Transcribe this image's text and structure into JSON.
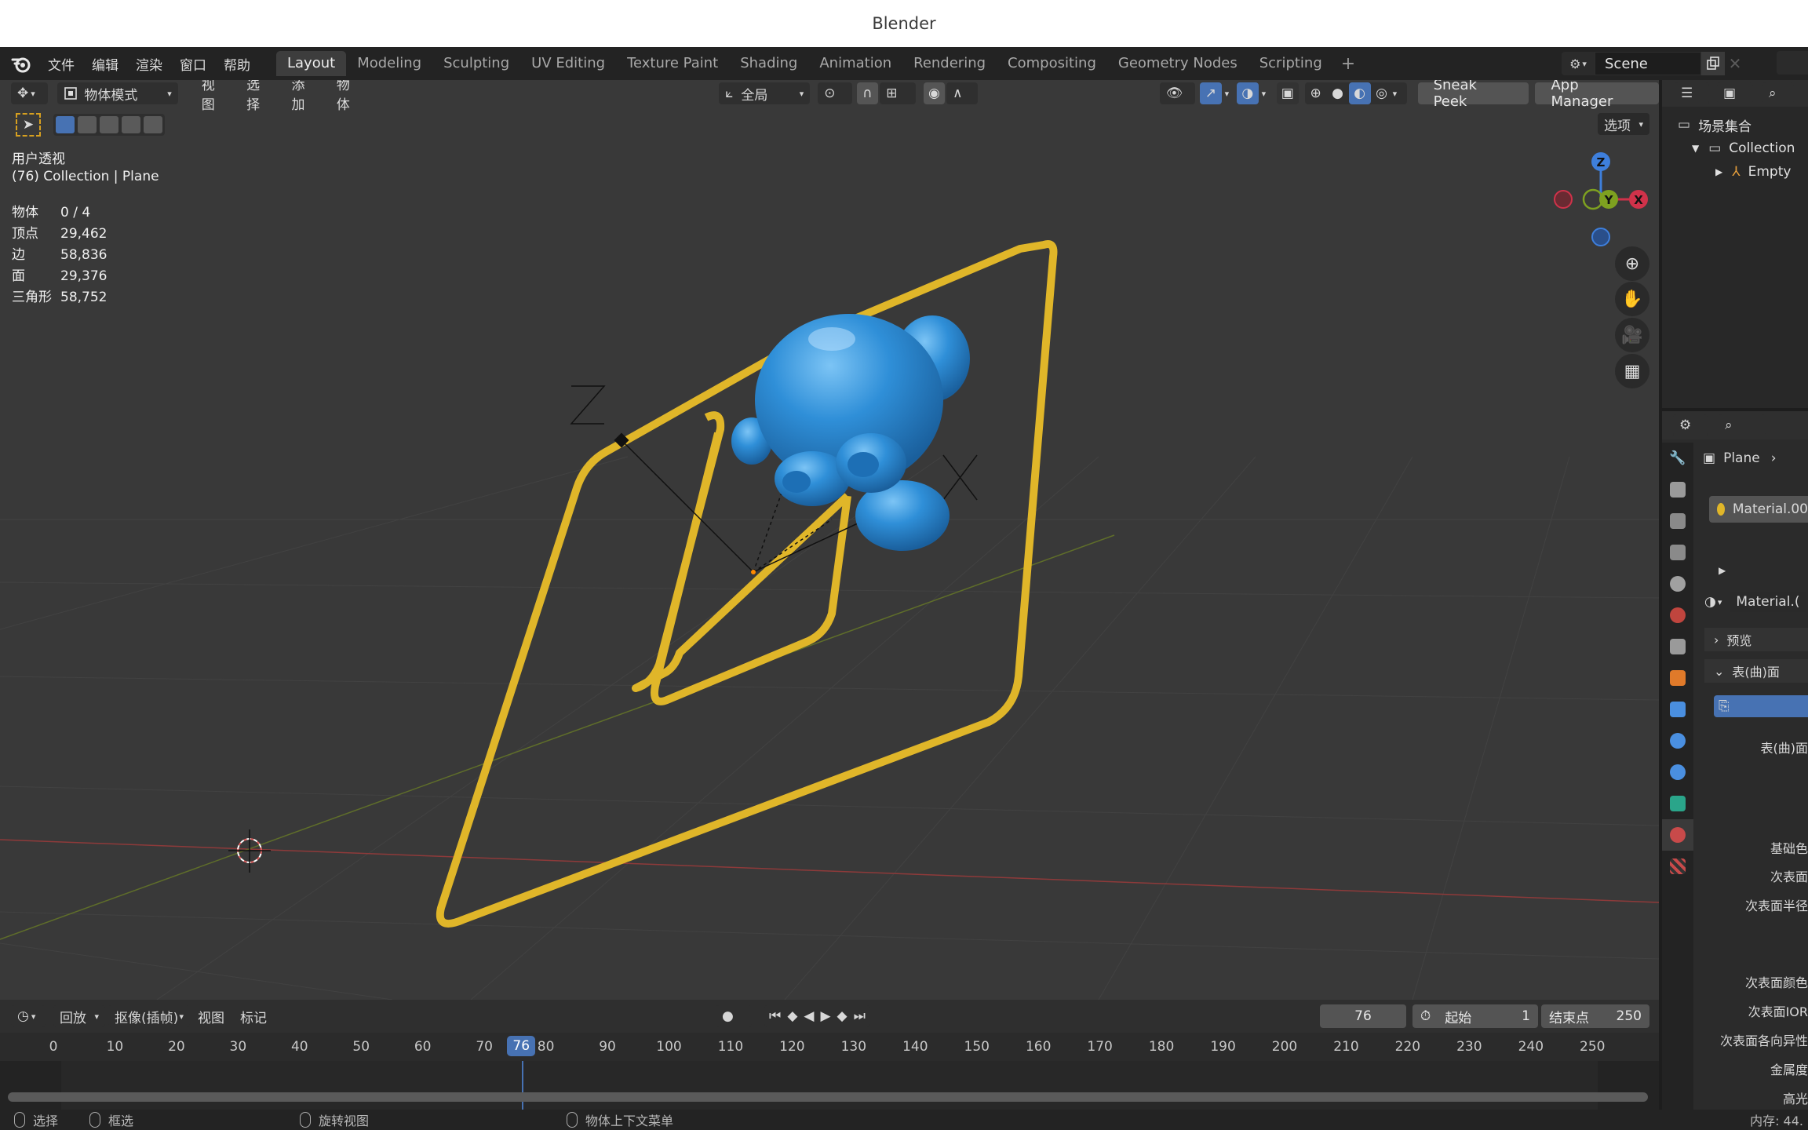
{
  "window_title": "Blender",
  "menu": {
    "items": [
      "文件",
      "编辑",
      "渲染",
      "窗口",
      "帮助"
    ]
  },
  "workspaces": {
    "tabs": [
      "Layout",
      "Modeling",
      "Sculpting",
      "UV Editing",
      "Texture Paint",
      "Shading",
      "Animation",
      "Rendering",
      "Compositing",
      "Geometry Nodes",
      "Scripting"
    ],
    "active": "Layout",
    "add_label": "+"
  },
  "scene": {
    "name": "Scene"
  },
  "viewport": {
    "mode_label": "物体模式",
    "menus": [
      "视图",
      "选择",
      "添加",
      "物体"
    ],
    "transform_orientation": "全局",
    "sneak_peek": "Sneak Peek",
    "app_manager": "App Manager",
    "options_label": "选项",
    "view_name": "用户透视",
    "context_line": "(76) Collection | Plane",
    "stats": [
      {
        "label": "物体",
        "value": "0 / 4"
      },
      {
        "label": "顶点",
        "value": "29,462"
      },
      {
        "label": "边",
        "value": "58,836"
      },
      {
        "label": "面",
        "value": "29,376"
      },
      {
        "label": "三角形",
        "value": "58,752"
      }
    ],
    "axes": {
      "z": "Z",
      "y": "Y",
      "x": "X"
    }
  },
  "timeline": {
    "playback_label": "回放",
    "keying_label": "抠像(插帧)",
    "view_label": "视图",
    "marker_label": "标记",
    "current_frame": "76",
    "start_label": "起始",
    "start_value": "1",
    "end_label": "结束点",
    "end_value": "250",
    "ticks": [
      "0",
      "10",
      "20",
      "30",
      "40",
      "50",
      "60",
      "70",
      "80",
      "90",
      "100",
      "110",
      "120",
      "130",
      "140",
      "150",
      "160",
      "170",
      "180",
      "190",
      "200",
      "210",
      "220",
      "230",
      "240",
      "250"
    ]
  },
  "outliner": {
    "rows": [
      "场景集合",
      "Collection",
      "Empty"
    ]
  },
  "properties": {
    "object_name": "Plane",
    "material_slot": "Material.00",
    "material_name": "Material.(",
    "preview_label": "预览",
    "surface_label": "表(曲)面",
    "surface_field_label": "表(曲)面",
    "param_labels": [
      "基础色",
      "次表面",
      "次表面半径",
      "次表面颜色",
      "次表面IOR",
      "次表面各向异性",
      "金属度",
      "高光"
    ]
  },
  "statusbar": {
    "select": "选择",
    "box_select": "框选",
    "rotate_view": "旋转视图",
    "context_menu": "物体上下文菜单",
    "memory": "内存: 44."
  },
  "colors": {
    "accent_blue": "#4772b3",
    "curve_yellow": "#e0b629",
    "monkey_blue": "#2f8fd8",
    "axis_red": "#d0324a",
    "axis_green": "#7ea120",
    "axis_blue": "#3e7fdc"
  }
}
